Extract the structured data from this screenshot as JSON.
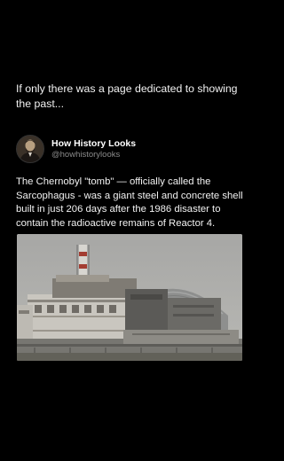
{
  "caption": "If only there was a page dedicated to showing the past...",
  "post": {
    "author_name": "How History Looks",
    "author_handle": "@howhistorylooks",
    "text": "The Chernobyl \"tomb\" — officially called the Sarcophagus - was a giant steel and concrete shell built in just 206 days after the 1986 disaster to contain the radioactive remains of Reactor 4."
  },
  "colors": {
    "background": "#000000",
    "text": "#f2f2f2",
    "handle": "#8b8b8b"
  }
}
